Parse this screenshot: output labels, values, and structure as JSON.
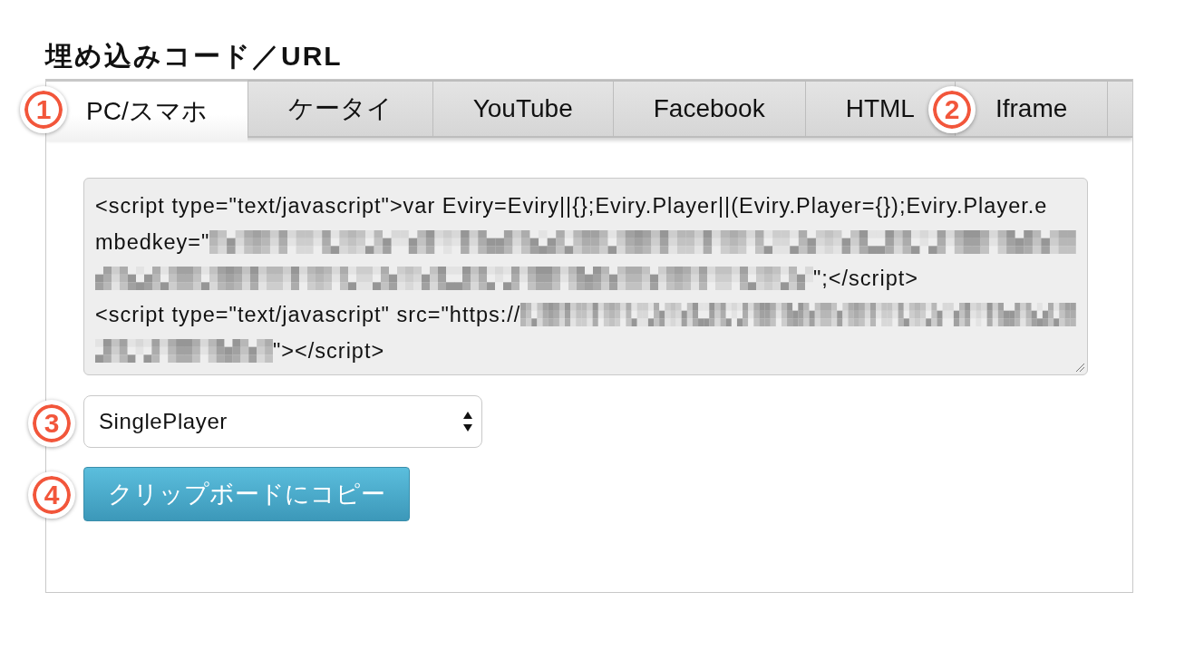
{
  "title": "埋め込みコード／URL",
  "tabs": [
    {
      "label": "PC/スマホ",
      "selected": true
    },
    {
      "label": "ケータイ",
      "selected": false
    },
    {
      "label": "YouTube",
      "selected": false
    },
    {
      "label": "Facebook",
      "selected": false
    },
    {
      "label": "HTML",
      "selected": false
    },
    {
      "label": "Iframe",
      "selected": false
    },
    {
      "selected": false
    }
  ],
  "code_box": {
    "lines": [
      [
        {
          "kind": "text",
          "text": "<script type=\"text/javascript\">var Eviry=Eviry||{};Eviry.Player||(Eviry.Player={});Eviry.Player.e"
        }
      ],
      [
        {
          "kind": "text",
          "text": "mbedkey=\""
        },
        {
          "kind": "redacted"
        }
      ],
      [
        {
          "kind": "redacted"
        },
        {
          "kind": "text",
          "text": "\";</script>"
        }
      ],
      [
        {
          "kind": "text",
          "text": "<script type=\"text/javascript\" src=\"https://"
        },
        {
          "kind": "redacted"
        }
      ],
      [
        {
          "kind": "redacted"
        },
        {
          "kind": "text",
          "text": "\"></script>"
        }
      ]
    ]
  },
  "player_select": {
    "value": "SinglePlayer"
  },
  "copy_button": {
    "label": "クリップボードにコピー"
  },
  "callouts": [
    {
      "number": "1"
    },
    {
      "number": "2"
    },
    {
      "number": "3"
    },
    {
      "number": "4"
    }
  ]
}
